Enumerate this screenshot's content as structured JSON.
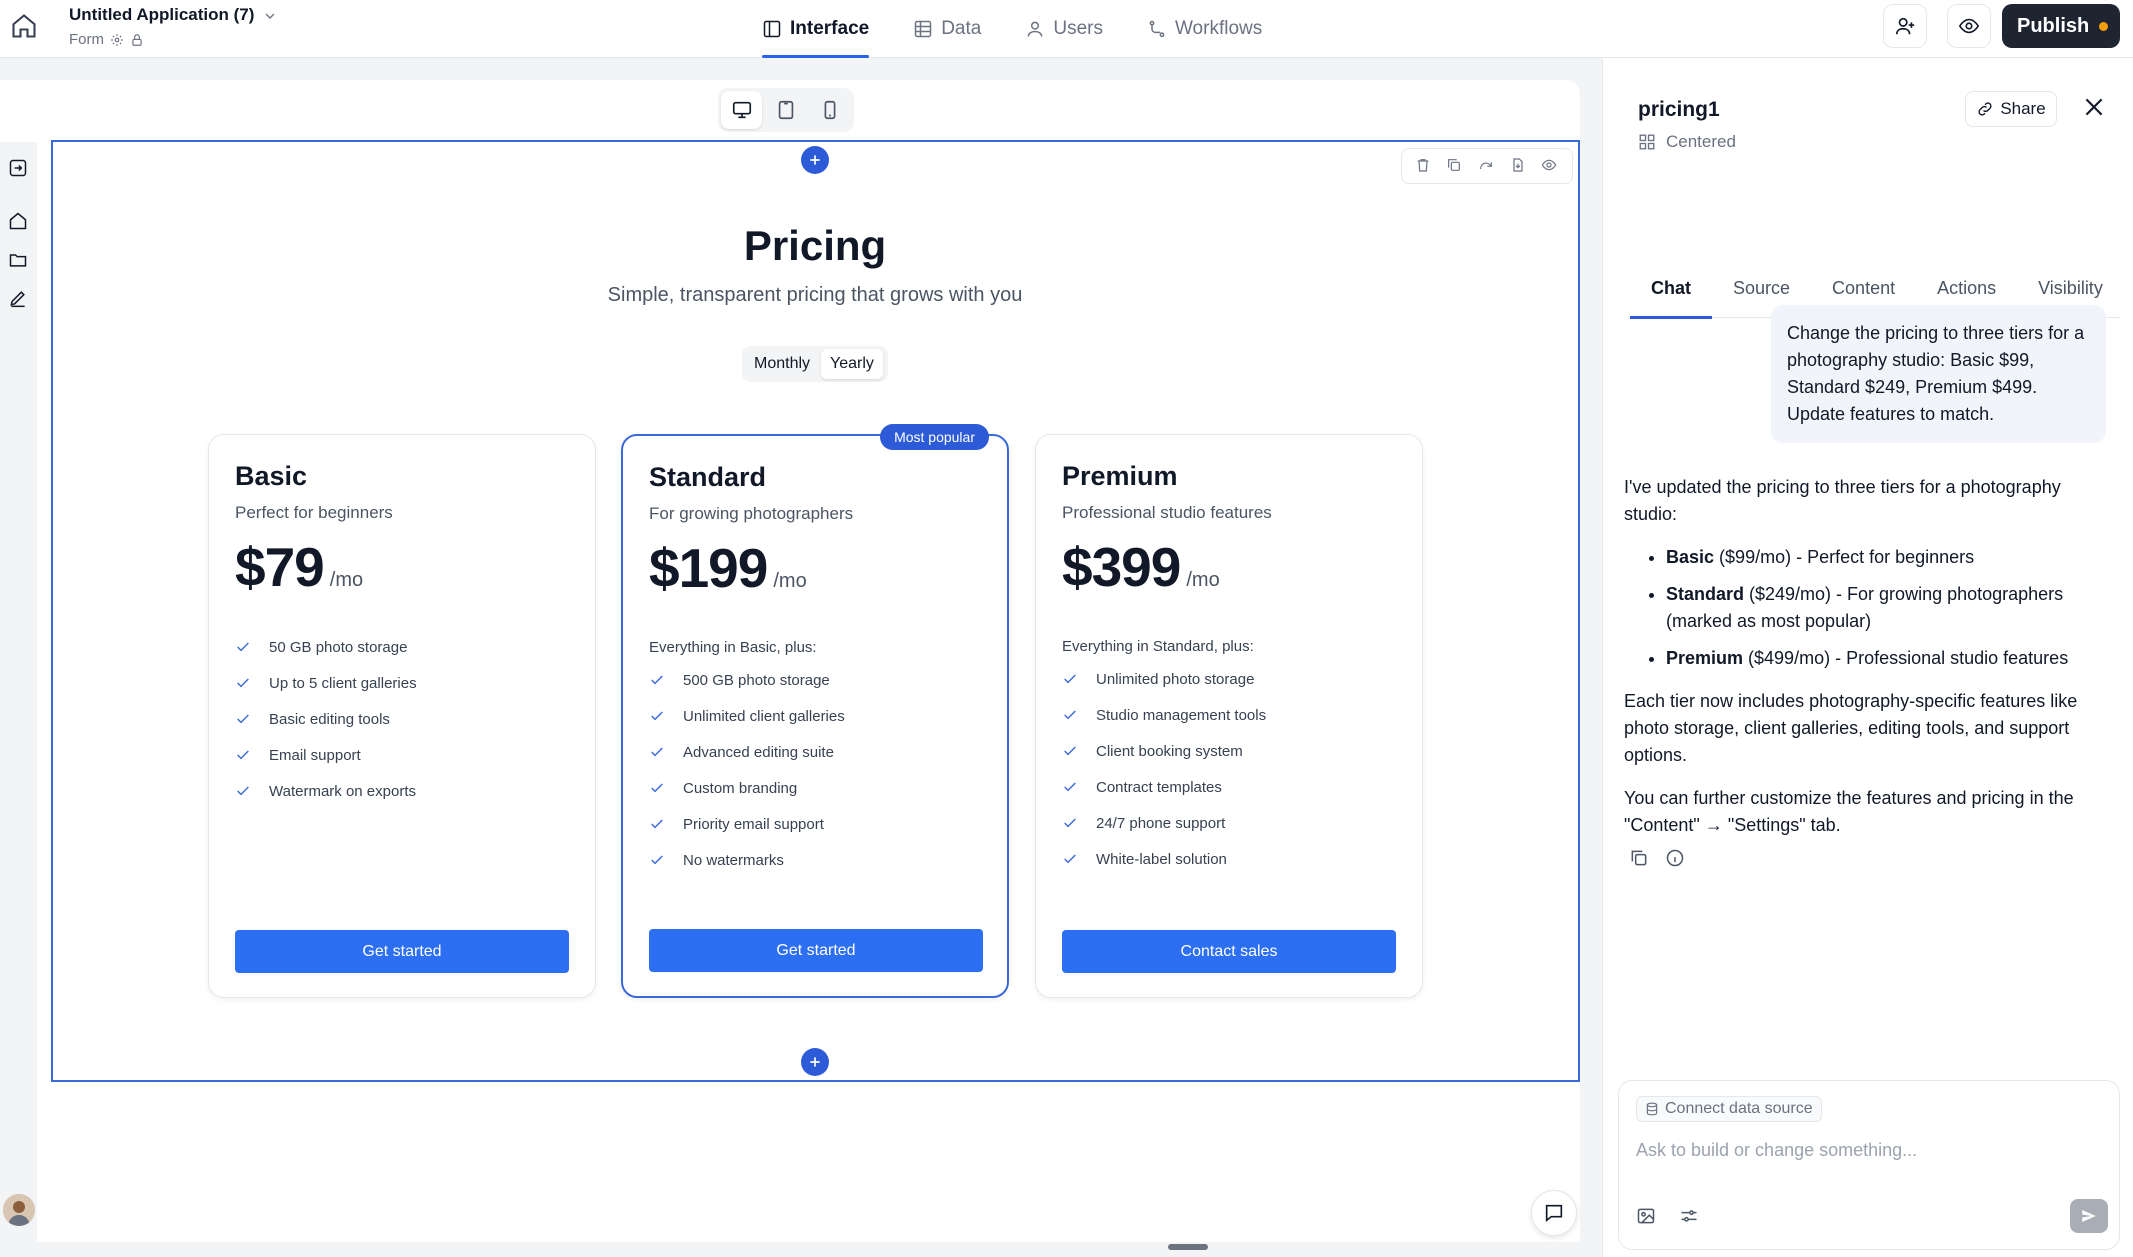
{
  "app": {
    "title": "Untitled Application (7)",
    "subtitle": "Form"
  },
  "nav": {
    "tabs": [
      {
        "label": "Interface"
      },
      {
        "label": "Data"
      },
      {
        "label": "Users"
      },
      {
        "label": "Workflows"
      }
    ]
  },
  "toolbar": {
    "publish_label": "Publish"
  },
  "billing": {
    "monthly": "Monthly",
    "yearly": "Yearly",
    "selected": "Yearly"
  },
  "pricing": {
    "title": "Pricing",
    "subtitle": "Simple, transparent pricing that grows with you",
    "badge": "Most popular",
    "plans": [
      {
        "name": "Basic",
        "desc": "Perfect for beginners",
        "price": "$79",
        "per": "/mo",
        "intro": "",
        "features": [
          "50 GB photo storage",
          "Up to 5 client galleries",
          "Basic editing tools",
          "Email support",
          "Watermark on exports"
        ],
        "cta": "Get started"
      },
      {
        "name": "Standard",
        "desc": "For growing photographers",
        "price": "$199",
        "per": "/mo",
        "intro": "Everything in Basic, plus:",
        "features": [
          "500 GB photo storage",
          "Unlimited client galleries",
          "Advanced editing suite",
          "Custom branding",
          "Priority email support",
          "No watermarks"
        ],
        "cta": "Get started"
      },
      {
        "name": "Premium",
        "desc": "Professional studio features",
        "price": "$399",
        "per": "/mo",
        "intro": "Everything in Standard, plus:",
        "features": [
          "Unlimited photo storage",
          "Studio management tools",
          "Client booking system",
          "Contract templates",
          "24/7 phone support",
          "White-label solution"
        ],
        "cta": "Contact sales"
      }
    ]
  },
  "panel": {
    "title": "pricing1",
    "subtitle": "Centered",
    "share_label": "Share",
    "tabs": [
      "Chat",
      "Source",
      "Content",
      "Actions",
      "Visibility"
    ],
    "user_message": "Change the pricing to three tiers for a photography studio: Basic $99, Standard $249, Premium $499. Update features to match.",
    "assistant": {
      "intro": "I've updated the pricing to three tiers for a photography studio:",
      "bullets": [
        {
          "name": "Basic",
          "detail": " ($99/mo) - Perfect for beginners"
        },
        {
          "name": "Standard",
          "detail": " ($249/mo) - For growing photographers (marked as most popular)"
        },
        {
          "name": "Premium",
          "detail": " ($499/mo) - Professional studio features"
        }
      ],
      "para1": "Each tier now includes photography-specific features like photo storage, client galleries, editing tools, and support options.",
      "para2": "You can further customize the features and pricing in the \"Content\" → \"Settings\" tab."
    },
    "composer": {
      "connect_label": "Connect data source",
      "placeholder": "Ask to build or change something..."
    }
  },
  "colors": {
    "accent": "#2d5bd8",
    "button": "#2d6ff2",
    "publish_bg": "#1e2430"
  }
}
